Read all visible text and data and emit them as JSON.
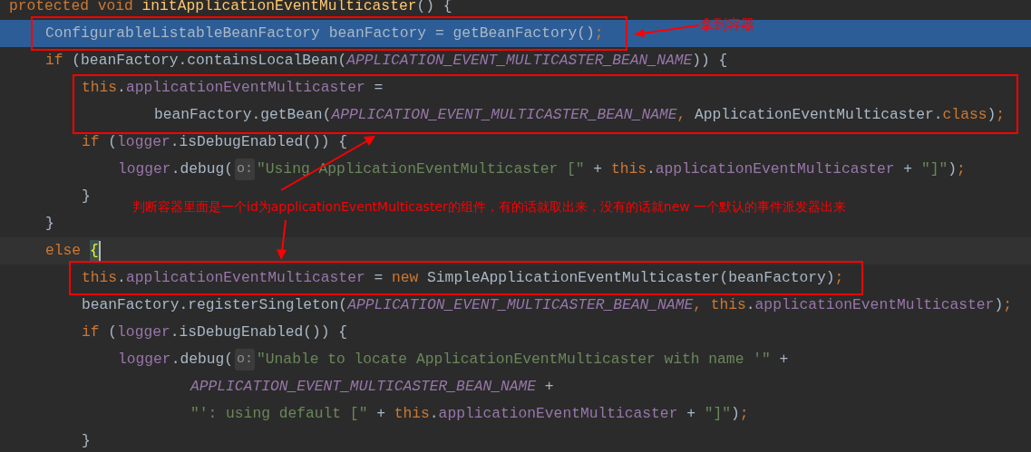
{
  "code_lines": [
    {
      "selected": false,
      "caret": false,
      "tokens": [
        {
          "kind": "keyword",
          "text": "protected void "
        },
        {
          "kind": "method",
          "text": "initApplicationEventMulticaster"
        },
        {
          "kind": "plain",
          "text": "() {"
        }
      ],
      "children": [
        {
          "selected": true,
          "caret": false,
          "tokens": [
            {
              "kind": "plain",
              "text": "ConfigurableListableBeanFactory beanFactory = getBeanFactory()"
            },
            {
              "kind": "keyword",
              "text": ";"
            }
          ]
        },
        {
          "selected": false,
          "caret": false,
          "tokens": [
            {
              "kind": "keyword",
              "text": "if"
            },
            {
              "kind": "plain",
              "text": " (beanFactory.containsLocalBean("
            },
            {
              "kind": "constant",
              "text": "APPLICATION_EVENT_MULTICASTER_BEAN_NAME"
            },
            {
              "kind": "plain",
              "text": ")) {"
            }
          ],
          "children": [
            {
              "selected": false,
              "caret": false,
              "tokens": [
                {
                  "kind": "keyword",
                  "text": "this"
                },
                {
                  "kind": "plain",
                  "text": "."
                },
                {
                  "kind": "field",
                  "text": "applicationEventMulticaster"
                },
                {
                  "kind": "plain",
                  "text": " ="
                }
              ],
              "children": [
                {
                  "kind": "continuation",
                  "selected": false,
                  "caret": false,
                  "tokens": [
                    {
                      "kind": "plain",
                      "text": "beanFactory.getBean("
                    },
                    {
                      "kind": "constant",
                      "text": "APPLICATION_EVENT_MULTICASTER_BEAN_NAME"
                    },
                    {
                      "kind": "keyword",
                      "text": ", "
                    },
                    {
                      "kind": "plain",
                      "text": "ApplicationEventMulticaster."
                    },
                    {
                      "kind": "keyword",
                      "text": "class"
                    },
                    {
                      "kind": "plain",
                      "text": ")"
                    },
                    {
                      "kind": "keyword",
                      "text": ";"
                    }
                  ]
                }
              ]
            },
            {
              "selected": false,
              "caret": false,
              "tokens": [
                {
                  "kind": "keyword",
                  "text": "if"
                },
                {
                  "kind": "plain",
                  "text": " ("
                },
                {
                  "kind": "field",
                  "text": "logger"
                },
                {
                  "kind": "plain",
                  "text": ".isDebugEnabled()) {"
                }
              ],
              "children": [
                {
                  "selected": false,
                  "caret": false,
                  "tokens": [
                    {
                      "kind": "field",
                      "text": "logger"
                    },
                    {
                      "kind": "plain",
                      "text": ".debug("
                    },
                    {
                      "kind": "hint",
                      "text": "o:"
                    },
                    {
                      "kind": "string",
                      "text": "\"Using ApplicationEventMulticaster [\""
                    },
                    {
                      "kind": "plain",
                      "text": " + "
                    },
                    {
                      "kind": "keyword",
                      "text": "this"
                    },
                    {
                      "kind": "plain",
                      "text": "."
                    },
                    {
                      "kind": "field",
                      "text": "applicationEventMulticaster"
                    },
                    {
                      "kind": "plain",
                      "text": " + "
                    },
                    {
                      "kind": "string",
                      "text": "\"]\""
                    },
                    {
                      "kind": "plain",
                      "text": ")"
                    },
                    {
                      "kind": "keyword",
                      "text": ";"
                    }
                  ]
                }
              ]
            },
            {
              "selected": false,
              "caret": false,
              "tokens": [
                {
                  "kind": "plain",
                  "text": "}"
                }
              ]
            }
          ]
        },
        {
          "selected": false,
          "caret": false,
          "tokens": [
            {
              "kind": "plain",
              "text": "}"
            }
          ]
        },
        {
          "selected": false,
          "caret": true,
          "tokens": [
            {
              "kind": "keyword",
              "text": "else"
            },
            {
              "kind": "brace",
              "text": "{"
            }
          ],
          "children": [
            {
              "selected": false,
              "caret": false,
              "tokens": [
                {
                  "kind": "keyword",
                  "text": "this"
                },
                {
                  "kind": "plain",
                  "text": "."
                },
                {
                  "kind": "field",
                  "text": "applicationEventMulticaster"
                },
                {
                  "kind": "plain",
                  "text": " = "
                },
                {
                  "kind": "keyword",
                  "text": "new"
                },
                {
                  "kind": "plain",
                  "text": " SimpleApplicationEventMulticaster(beanFactory)"
                },
                {
                  "kind": "keyword",
                  "text": ";"
                }
              ]
            },
            {
              "selected": false,
              "caret": false,
              "tokens": [
                {
                  "kind": "plain",
                  "text": "beanFactory.registerSingleton("
                },
                {
                  "kind": "constant",
                  "text": "APPLICATION_EVENT_MULTICASTER_BEAN_NAME"
                },
                {
                  "kind": "keyword",
                  "text": ", "
                },
                {
                  "kind": "keyword",
                  "text": "this"
                },
                {
                  "kind": "plain",
                  "text": "."
                },
                {
                  "kind": "field",
                  "text": "applicationEventMulticaster"
                },
                {
                  "kind": "plain",
                  "text": ")"
                },
                {
                  "kind": "keyword",
                  "text": ";"
                }
              ]
            },
            {
              "selected": false,
              "caret": false,
              "tokens": [
                {
                  "kind": "keyword",
                  "text": "if"
                },
                {
                  "kind": "plain",
                  "text": " ("
                },
                {
                  "kind": "field",
                  "text": "logger"
                },
                {
                  "kind": "plain",
                  "text": ".isDebugEnabled()) {"
                }
              ],
              "children": [
                {
                  "selected": false,
                  "caret": false,
                  "tokens": [
                    {
                      "kind": "field",
                      "text": "logger"
                    },
                    {
                      "kind": "plain",
                      "text": ".debug("
                    },
                    {
                      "kind": "hint",
                      "text": "o:"
                    },
                    {
                      "kind": "string",
                      "text": "\"Unable to locate ApplicationEventMulticaster with name '\""
                    },
                    {
                      "kind": "plain",
                      "text": " +"
                    }
                  ],
                  "children": [
                    {
                      "kind": "continuation",
                      "selected": false,
                      "caret": false,
                      "tokens": [
                        {
                          "kind": "constant",
                          "text": "APPLICATION_EVENT_MULTICASTER_BEAN_NAME"
                        },
                        {
                          "kind": "plain",
                          "text": " +"
                        }
                      ]
                    },
                    {
                      "kind": "continuation",
                      "selected": false,
                      "caret": false,
                      "tokens": [
                        {
                          "kind": "string",
                          "text": "\"': using default [\""
                        },
                        {
                          "kind": "plain",
                          "text": " + "
                        },
                        {
                          "kind": "keyword",
                          "text": "this"
                        },
                        {
                          "kind": "plain",
                          "text": "."
                        },
                        {
                          "kind": "field",
                          "text": "applicationEventMulticaster"
                        },
                        {
                          "kind": "plain",
                          "text": " + "
                        },
                        {
                          "kind": "string",
                          "text": "\"]\""
                        },
                        {
                          "kind": "plain",
                          "text": ")"
                        },
                        {
                          "kind": "keyword",
                          "text": ";"
                        }
                      ]
                    }
                  ]
                }
              ]
            },
            {
              "selected": false,
              "caret": false,
              "tokens": [
                {
                  "kind": "plain",
                  "text": "}"
                }
              ]
            }
          ]
        }
      ]
    }
  ],
  "annotations": [
    {
      "text": "拿到容器"
    },
    {
      "text": "判断容器里面是一个id为applicationEventMulticaster的组件，有的话就取出来，没有的话就new 一个默认的事件派发器出来"
    }
  ]
}
